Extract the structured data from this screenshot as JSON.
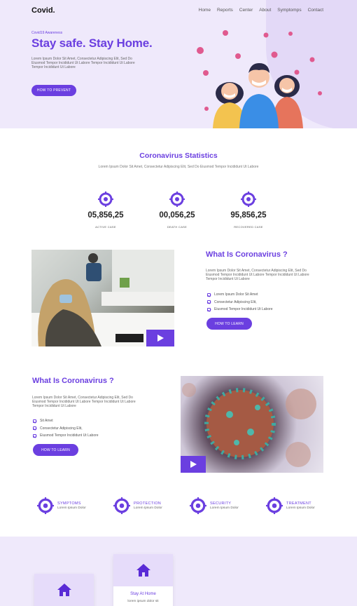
{
  "brand": {
    "logo": "Covid.",
    "accent": "#6b3fe0"
  },
  "nav": [
    "Home",
    "Reports",
    "Center",
    "About",
    "Symptomps",
    "Contact"
  ],
  "hero": {
    "eyebrow": "Covid19 Awareness",
    "title": "Stay safe. Stay Home.",
    "desc": "Lorem Ipsum Dolor Sit Amet, Consectetur Adipiscing Elit, Sed Do Eiusmod Tempor Incididunt Ut Labore Tempor Incididunt Ut Labore Tempor Incididunt Ut Labore",
    "button": "HOW TO PREVENT"
  },
  "stats": {
    "title": "Coronavirus Statistics",
    "subtitle": "Lorem Ipsum Dolor Sit Amet, Consectetur Adipiscing Elit, Sed Do Eiusmod Tempor Incididunt Ut Labore",
    "items": [
      {
        "value": "05,856,25",
        "label": "ACTIVE CASE"
      },
      {
        "value": "00,056,25",
        "label": "DEATH CASE"
      },
      {
        "value": "95,856,25",
        "label": "RECOVERED CASE"
      }
    ]
  },
  "section_a": {
    "title": "What Is Coronavirus ?",
    "desc": "Lorem Ipsum Dolor Sit Amet, Consectetur Adipiscing Elit, Sed Do Eiusmod Tempor Incididunt Ut Labore Tempor Incididunt Ut Labore Tempor Incididunt Ut Labore",
    "checks": [
      "Lorem Ipsum Dolor Sit Amet",
      "Consectetur Adipiscing Elit,",
      "Eiusmod Tempor Incididunt Ut Labore"
    ],
    "button": "HOW TO LEARN"
  },
  "section_b": {
    "title": "What Is Coronavirus ?",
    "desc": "Lorem Ipsum Dolor Sit Amet, Consectetur Adipiscing Elit, Sed Do Eiusmod Tempor Incididunt Ut Labore Tempor Incididunt Ut Labore Tempor Incididunt Ut Labore",
    "checks": [
      "Sit Amet",
      "Consectetur Adipiscing Elit,",
      "Eiusmod Tempor Incididunt Ut Labore"
    ],
    "button": "HOW TO LEARN"
  },
  "features": [
    {
      "title": "SYMPTOMS",
      "sub": "Lorem Ipsum Dolor"
    },
    {
      "title": "PROTECTION",
      "sub": "Lorem Ipsum Dolor"
    },
    {
      "title": "SECURITY",
      "sub": "Lorem Ipsum Dolor"
    },
    {
      "title": "TREATMENT",
      "sub": "Lorem Ipsum Dolor"
    }
  ],
  "cards": [
    {
      "title": "Stay At Home",
      "sub": "lorem ipsum dolor sit"
    }
  ]
}
